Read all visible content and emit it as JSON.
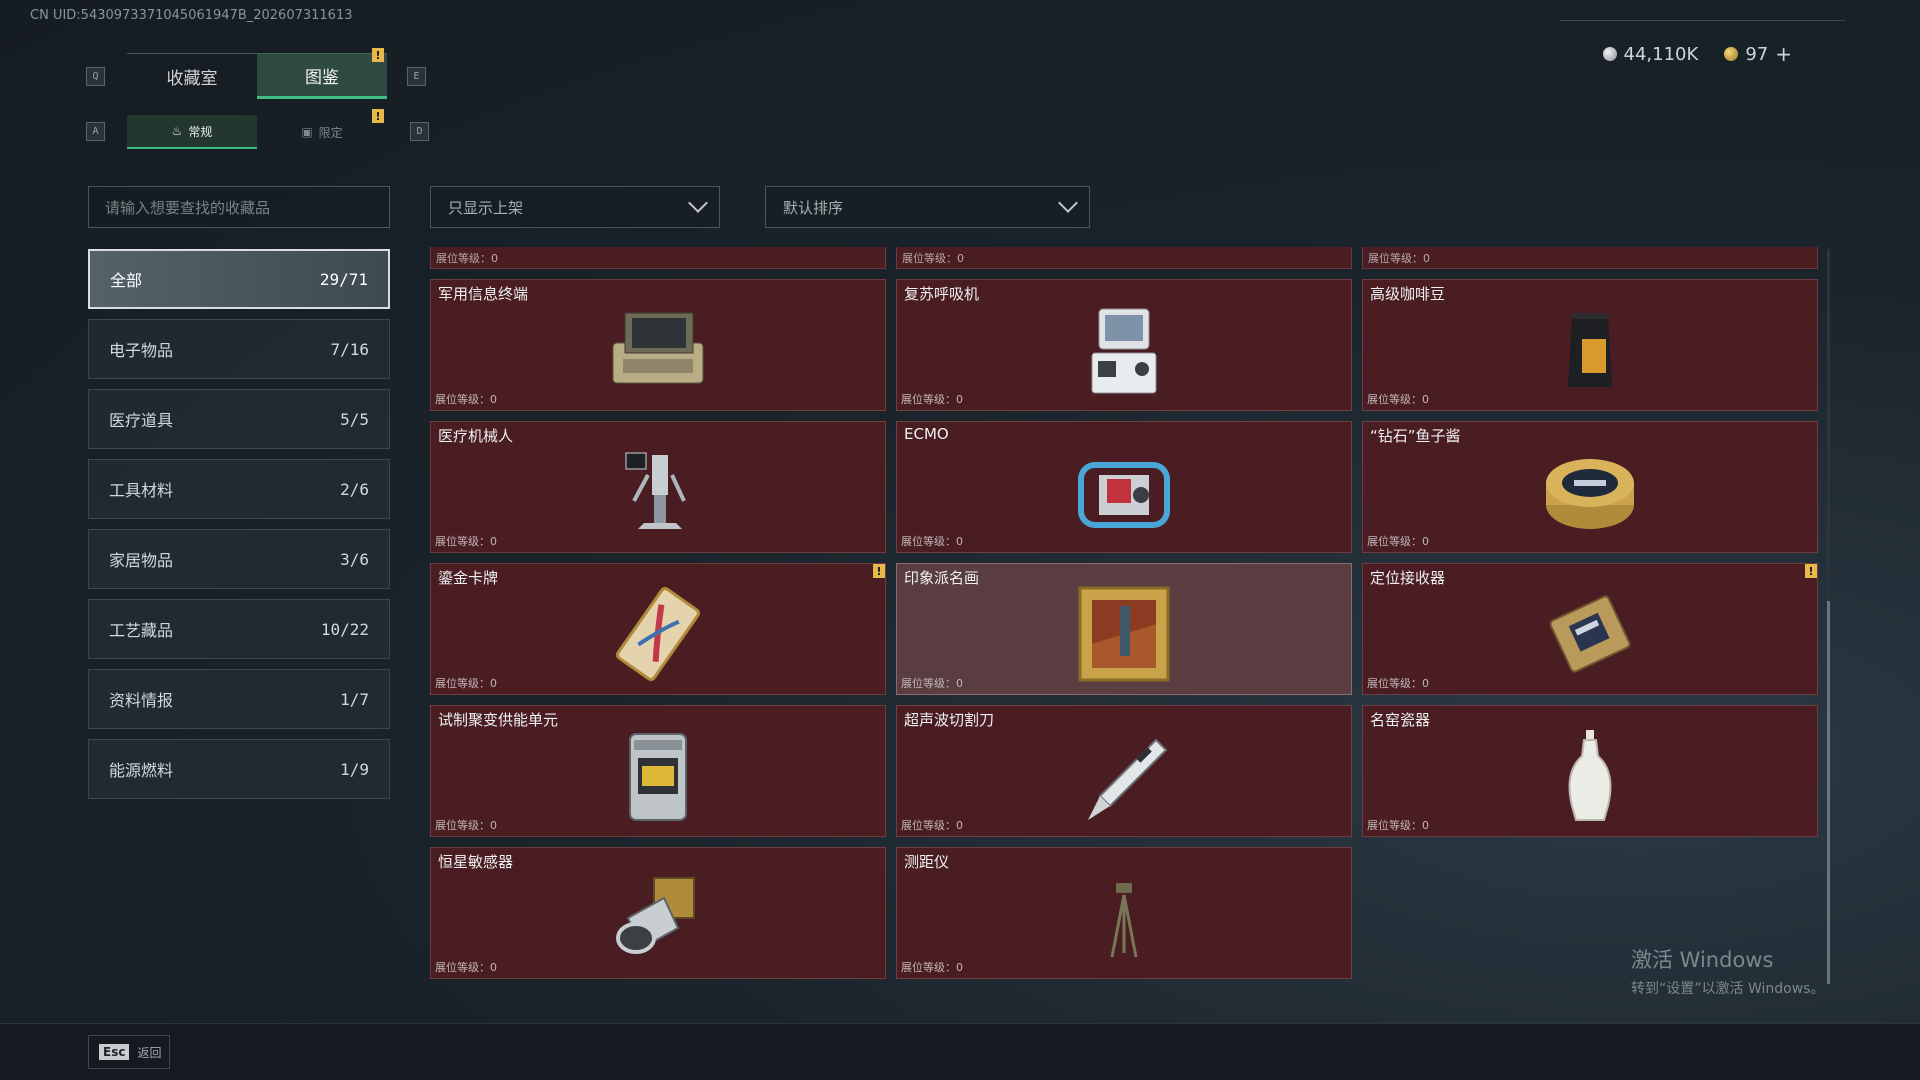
{
  "uid": "CN UID:5430973371045061947B_202607311613",
  "currency": {
    "silver": "44,110K",
    "gold": "97",
    "plus": "+"
  },
  "keys": {
    "q": "Q",
    "e": "E",
    "a": "A",
    "d": "D",
    "esc": "Esc"
  },
  "tabs": [
    {
      "label": "收藏室"
    },
    {
      "label": "图鉴"
    }
  ],
  "subtabs": [
    {
      "label": "常规"
    },
    {
      "label": "限定"
    }
  ],
  "search": {
    "placeholder": "请输入想要查找的收藏品"
  },
  "filters": {
    "shelf": "只显示上架",
    "sort": "默认排序"
  },
  "categories": [
    {
      "label": "全部",
      "count": "29/71"
    },
    {
      "label": "电子物品",
      "count": "7/16"
    },
    {
      "label": "医疗道具",
      "count": "5/5"
    },
    {
      "label": "工具材料",
      "count": "2/6"
    },
    {
      "label": "家居物品",
      "count": "3/6"
    },
    {
      "label": "工艺藏品",
      "count": "10/22"
    },
    {
      "label": "资料情报",
      "count": "1/7"
    },
    {
      "label": "能源燃料",
      "count": "1/9"
    }
  ],
  "level_label": "展位等级：0",
  "items": [
    {
      "name": "军用信息终端"
    },
    {
      "name": "复苏呼吸机"
    },
    {
      "name": "高级咖啡豆"
    },
    {
      "name": "医疗机械人"
    },
    {
      "name": "ECMO"
    },
    {
      "name": "“钻石”鱼子酱"
    },
    {
      "name": "鎏金卡牌"
    },
    {
      "name": "印象派名画"
    },
    {
      "name": "定位接收器"
    },
    {
      "name": "试制聚变供能单元"
    },
    {
      "name": "超声波切割刀"
    },
    {
      "name": "名窑瓷器"
    },
    {
      "name": "恒星敏感器"
    },
    {
      "name": "测距仪"
    }
  ],
  "watermark": {
    "title": "激活 Windows",
    "subtitle": "转到“设置”以激活 Windows。"
  },
  "back_label": "返回",
  "colors": {
    "accent": "#3fbd84",
    "card_bg": "#4a1d22",
    "warning": "#e7b84a"
  }
}
